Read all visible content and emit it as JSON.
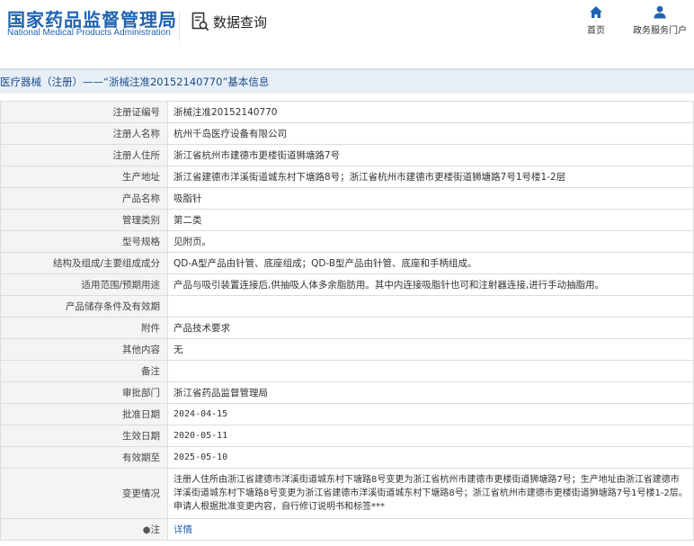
{
  "header": {
    "logo_cn": "国家药品监督管理局",
    "logo_en": "National Medical Products Administration",
    "query_label": "数据查询",
    "query_icon": "document-search-icon",
    "nav": [
      {
        "label": "首页",
        "icon": "home-icon"
      },
      {
        "label": "政务服务门户",
        "icon": "user-icon"
      }
    ]
  },
  "title": "医疗器械（注册）——“浙械注准20152140770”基本信息",
  "rows": [
    {
      "key": "注册证编号",
      "value": "浙械注准20152140770"
    },
    {
      "key": "注册人名称",
      "value": "杭州千岛医疗设备有限公司"
    },
    {
      "key": "注册人住所",
      "value": "浙江省杭州市建德市更楼街道狮塘路7号"
    },
    {
      "key": "生产地址",
      "value": "浙江省建德市洋溪街道城东村下塘路8号；浙江省杭州市建德市更楼街道狮塘路7号1号楼1-2层"
    },
    {
      "key": "产品名称",
      "value": "吸脂针"
    },
    {
      "key": "管理类别",
      "value": "第二类"
    },
    {
      "key": "型号规格",
      "value": "见附页。"
    },
    {
      "key": "结构及组成/主要组成成分",
      "value": "QD-A型产品由针管、底座组成；QD-B型产品由针管、底座和手柄组成。"
    },
    {
      "key": "适用范围/预期用途",
      "value": "产品与吸引装置连接后,供抽吸人体多余脂肪用。其中内连接吸脂针也可和注射器连接,进行手动抽脂用。"
    },
    {
      "key": "产品储存条件及有效期",
      "value": ""
    },
    {
      "key": "附件",
      "value": "产品技术要求"
    },
    {
      "key": "其他内容",
      "value": "无"
    },
    {
      "key": "备注",
      "value": ""
    },
    {
      "key": "审批部门",
      "value": "浙江省药品监督管理局"
    },
    {
      "key": "批准日期",
      "value": "2024-04-15"
    },
    {
      "key": "生效日期",
      "value": "2020-05-11"
    },
    {
      "key": "有效期至",
      "value": "2025-05-10"
    },
    {
      "key": "变更情况",
      "value": "注册人住所由浙江省建德市洋溪街道城东村下塘路8号变更为浙江省杭州市建德市更楼街道狮塘路7号；生产地址由浙江省建德市洋溪街道城东村下塘路8号变更为浙江省建德市洋溪街道城东村下塘路8号；浙江省杭州市建德市更楼街道狮塘路7号1号楼1-2层。申请人根据批准变更内容，自行修订说明书和标签***"
    },
    {
      "key": "注",
      "value": "详情",
      "key_icon": "pin-icon"
    }
  ],
  "colors": {
    "brand": "#1f63b1",
    "title_bar": "#e7eef6",
    "key_bg": "#f4f4f4"
  }
}
